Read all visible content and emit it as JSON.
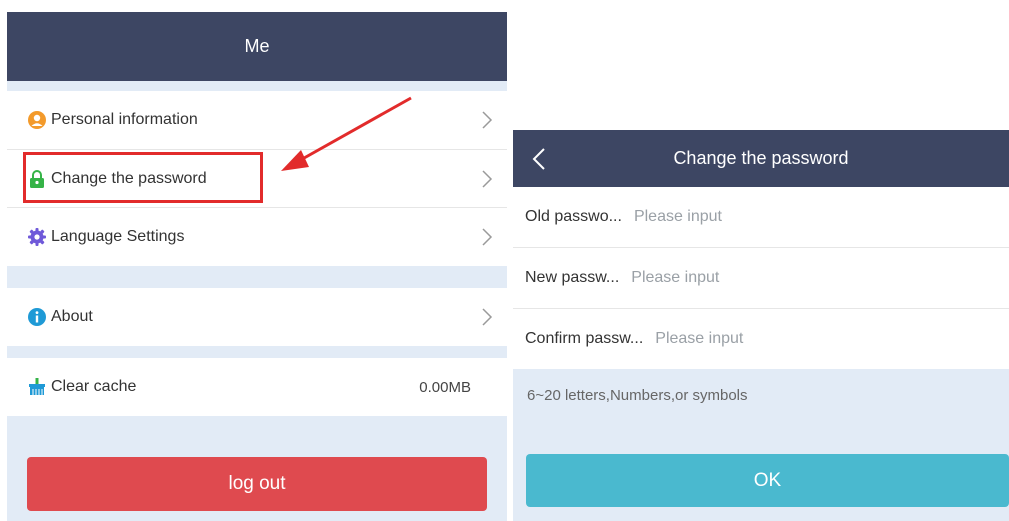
{
  "me_screen": {
    "title": "Me",
    "menu": {
      "personal_information": "Personal information",
      "change_password": "Change the password",
      "language_settings": "Language Settings",
      "about": "About",
      "clear_cache": "Clear cache",
      "cache_size": "0.00MB"
    },
    "logout_label": "log out"
  },
  "change_password_screen": {
    "title": "Change the password",
    "fields": {
      "old_label": "Old passwo...",
      "new_label": "New passw...",
      "confirm_label": "Confirm passw...",
      "placeholder": "Please input"
    },
    "hint": "6~20 letters,Numbers,or symbols",
    "ok_label": "OK"
  },
  "colors": {
    "header": "#3d4663",
    "background": "#e2ebf6",
    "logout": "#df4a4f",
    "ok": "#4ab9cf",
    "highlight": "#e22b2b"
  }
}
